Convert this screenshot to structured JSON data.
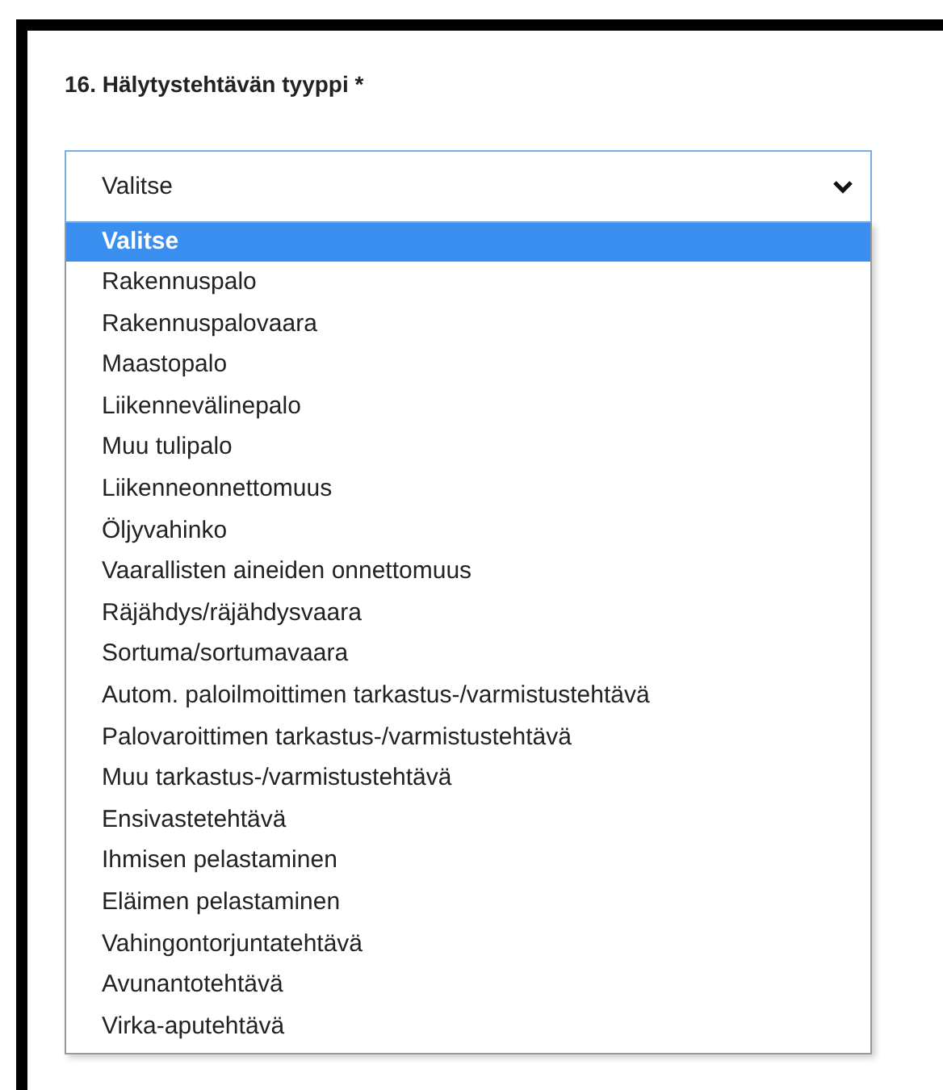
{
  "question": {
    "label": "16. Hälytystehtävän tyyppi *"
  },
  "select": {
    "value": "Valitse",
    "expanded": true
  },
  "options": [
    {
      "label": "Valitse",
      "selected": true
    },
    {
      "label": "Rakennuspalo",
      "selected": false
    },
    {
      "label": "Rakennuspalovaara",
      "selected": false
    },
    {
      "label": "Maastopalo",
      "selected": false
    },
    {
      "label": "Liikennevälinepalo",
      "selected": false
    },
    {
      "label": "Muu tulipalo",
      "selected": false
    },
    {
      "label": "Liikenneonnettomuus",
      "selected": false
    },
    {
      "label": "Öljyvahinko",
      "selected": false
    },
    {
      "label": "Vaarallisten aineiden onnettomuus",
      "selected": false
    },
    {
      "label": "Räjähdys/räjähdysvaara",
      "selected": false
    },
    {
      "label": "Sortuma/sortumavaara",
      "selected": false
    },
    {
      "label": "Autom. paloilmoittimen tarkastus-/varmistustehtävä",
      "selected": false
    },
    {
      "label": "Palovaroittimen tarkastus-/varmistustehtävä",
      "selected": false
    },
    {
      "label": "Muu tarkastus-/varmistustehtävä",
      "selected": false
    },
    {
      "label": "Ensivastetehtävä",
      "selected": false
    },
    {
      "label": "Ihmisen pelastaminen",
      "selected": false
    },
    {
      "label": "Eläimen pelastaminen",
      "selected": false
    },
    {
      "label": "Vahingontorjuntatehtävä",
      "selected": false
    },
    {
      "label": "Avunantotehtävä",
      "selected": false
    },
    {
      "label": "Virka-aputehtävä",
      "selected": false
    }
  ]
}
